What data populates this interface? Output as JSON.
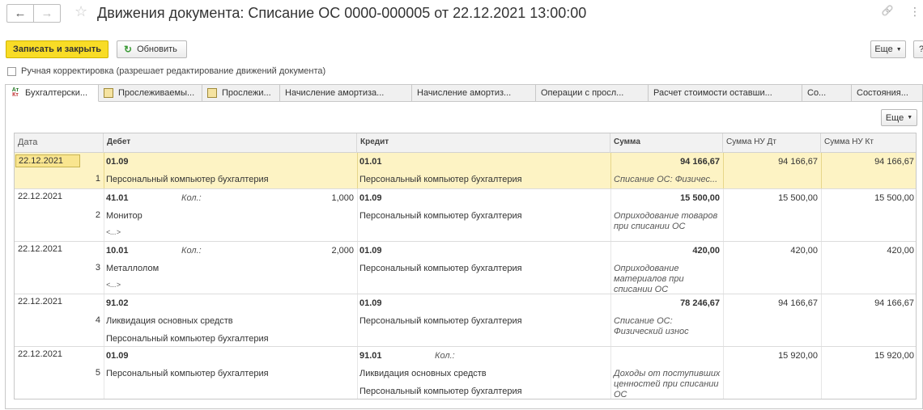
{
  "window": {
    "title": "Движения документа: Списание ОС 0000-000005 от 22.12.2021 13:00:00",
    "back_icon": "←",
    "forward_icon": "→",
    "star_icon": "☆",
    "link_icon": "🔗",
    "menu_icon": "⋮"
  },
  "toolbar": {
    "save_close": "Записать и закрыть",
    "refresh": "Обновить",
    "more": "Еще",
    "help": "?"
  },
  "manual_edit_label": "Ручная корректировка (разрешает редактирование движений документа)",
  "tabs": [
    {
      "label": "Бухгалтерски...",
      "icon": "atkt"
    },
    {
      "label": "Прослеживаемы...",
      "icon": "doc"
    },
    {
      "label": "Прослежи...",
      "icon": "doc"
    },
    {
      "label": "Начисление амортиза...",
      "icon": "grid"
    },
    {
      "label": "Начисление амортиз...",
      "icon": "grid"
    },
    {
      "label": "Операции с просл...",
      "icon": "grid"
    },
    {
      "label": "Расчет стоимости оставши...",
      "icon": "grid"
    },
    {
      "label": "Со...",
      "icon": "grid"
    },
    {
      "label": "Состояния...",
      "icon": "grid"
    }
  ],
  "panel_more": "Еще",
  "columns": {
    "date": "Дата",
    "debit": "Дебет",
    "credit": "Кредит",
    "sum": "Сумма",
    "sum_nu_dt": "Сумма НУ Дт",
    "sum_nu_kt": "Сумма НУ Кт"
  },
  "rows": [
    {
      "date": "22.12.2021",
      "num": "1",
      "dt_account": "01.09",
      "dt_qty_label": "",
      "dt_qty": "",
      "dt_sub1": "Персональный компьютер бухгалтерия",
      "dt_sub2": "",
      "kt_account": "01.01",
      "kt_qty_label": "",
      "kt_qty": "",
      "kt_sub1": "Персональный компьютер бухгалтерия",
      "kt_sub2": "",
      "sum": "94 166,67",
      "content": "Списание ОС: Физичес...",
      "nu_dt": "94 166,67",
      "nu_kt": "94 166,67"
    },
    {
      "date": "22.12.2021",
      "num": "2",
      "dt_account": "41.01",
      "dt_qty_label": "Кол.:",
      "dt_qty": "1,000",
      "dt_sub1": "Монитор",
      "dt_sub2": "<...>",
      "kt_account": "01.09",
      "kt_qty_label": "",
      "kt_qty": "",
      "kt_sub1": "Персональный компьютер бухгалтерия",
      "kt_sub2": "",
      "sum": "15 500,00",
      "content": "Оприходование товаров при списании ОС",
      "nu_dt": "15 500,00",
      "nu_kt": "15 500,00"
    },
    {
      "date": "22.12.2021",
      "num": "3",
      "dt_account": "10.01",
      "dt_qty_label": "Кол.:",
      "dt_qty": "2,000",
      "dt_sub1": "Металлолом",
      "dt_sub2": "<...>",
      "kt_account": "01.09",
      "kt_qty_label": "",
      "kt_qty": "",
      "kt_sub1": "Персональный компьютер бухгалтерия",
      "kt_sub2": "",
      "sum": "420,00",
      "content": "Оприходование материалов при списании ОС",
      "nu_dt": "420,00",
      "nu_kt": "420,00"
    },
    {
      "date": "22.12.2021",
      "num": "4",
      "dt_account": "91.02",
      "dt_qty_label": "",
      "dt_qty": "",
      "dt_sub1": "Ликвидация основных средств",
      "dt_sub2": "Персональный компьютер бухгалтерия",
      "kt_account": "01.09",
      "kt_qty_label": "",
      "kt_qty": "",
      "kt_sub1": "Персональный компьютер бухгалтерия",
      "kt_sub2": "",
      "sum": "78 246,67",
      "content": "Списание ОС: Физический износ",
      "nu_dt": "94 166,67",
      "nu_kt": "94 166,67"
    },
    {
      "date": "22.12.2021",
      "num": "5",
      "dt_account": "01.09",
      "dt_qty_label": "",
      "dt_qty": "",
      "dt_sub1": "Персональный компьютер бухгалтерия",
      "dt_sub2": "",
      "kt_account": "91.01",
      "kt_qty_label": "Кол.:",
      "kt_qty": "",
      "kt_sub1": "Ликвидация основных средств",
      "kt_sub2": "Персональный компьютер бухгалтерия",
      "sum": "",
      "content": "Доходы от поступивших ценностей при списании ОС",
      "nu_dt": "15 920,00",
      "nu_kt": "15 920,00"
    }
  ]
}
